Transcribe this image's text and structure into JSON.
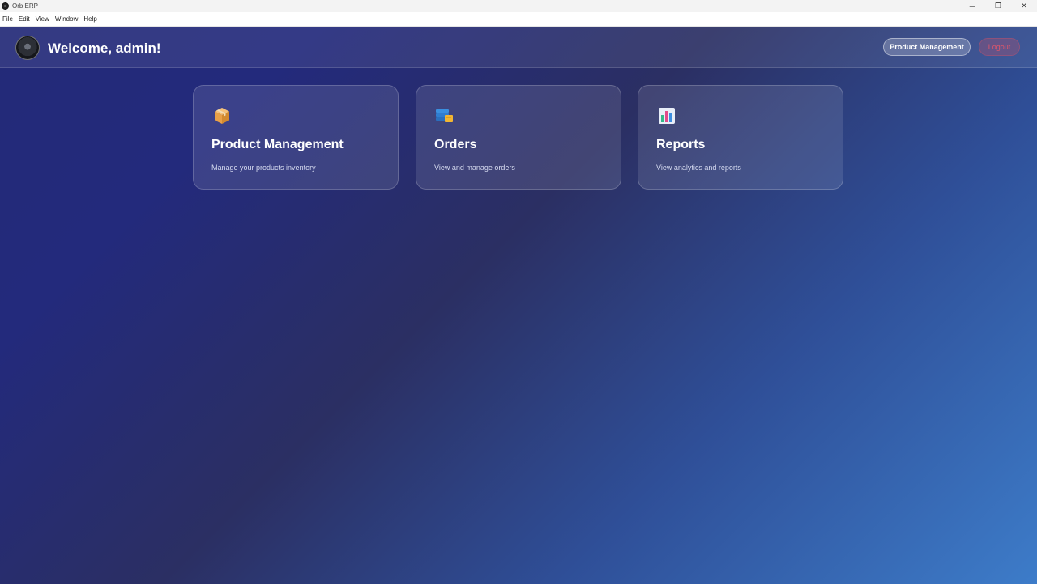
{
  "window": {
    "title": "Orb ERP",
    "controls": {
      "minimize": "─",
      "maximize": "❐",
      "close": "✕"
    }
  },
  "menu": [
    "File",
    "Edit",
    "View",
    "Window",
    "Help"
  ],
  "header": {
    "welcome": "Welcome, admin!",
    "product_management_label": "Product Management",
    "logout_label": "Logout"
  },
  "cards": [
    {
      "title": "Product Management",
      "description": "Manage your products inventory",
      "icon": "package-icon"
    },
    {
      "title": "Orders",
      "description": "View and manage orders",
      "icon": "orders-icon"
    },
    {
      "title": "Reports",
      "description": "View analytics and reports",
      "icon": "chart-icon"
    }
  ],
  "colors": {
    "gradient_start": "#232a78",
    "gradient_end": "#3d7cc9",
    "logout_text": "#e0566a"
  }
}
